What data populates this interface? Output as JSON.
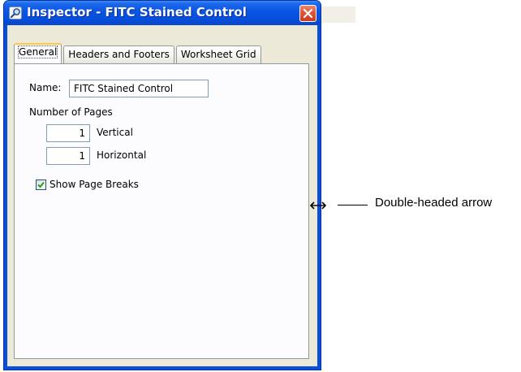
{
  "window": {
    "title": "Inspector - FITC Stained Control",
    "title_icon": "magnifier-icon",
    "close_icon": "close-icon",
    "frame_color": "#0a4fd8",
    "close_color": "#e1583a"
  },
  "tabs": [
    {
      "label": "General",
      "active": true
    },
    {
      "label": "Headers and Footers",
      "active": false
    },
    {
      "label": "Worksheet Grid",
      "active": false
    }
  ],
  "general": {
    "name_label": "Name:",
    "name_value": "FITC Stained Control",
    "pages_heading": "Number of Pages",
    "vertical_value": "1",
    "vertical_label": "Vertical",
    "horizontal_value": "1",
    "horizontal_label": "Horizontal",
    "show_breaks_label": "Show Page Breaks",
    "show_breaks_checked": true
  },
  "annotation": {
    "text": "Double-headed arrow",
    "icon": "double-headed-arrow-icon"
  }
}
